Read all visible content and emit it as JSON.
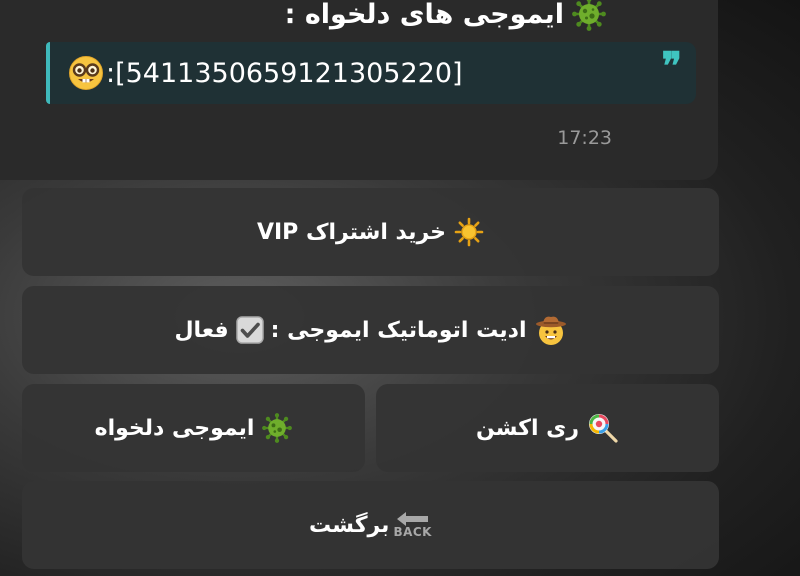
{
  "message": {
    "title": "ایموجی های دلخواه :",
    "title_icon": "virus-icon",
    "quote_mark": "❞",
    "quote_text": ":[5411350659121305220]",
    "quote_emoji": "nerd-face-icon",
    "time": "17:23",
    "accent_color": "#3fb9bb",
    "quote_bg": "#1f3135"
  },
  "keyboard": {
    "vip": {
      "label": "خرید اشتراک VIP",
      "icon": "sun-icon"
    },
    "auto_update": {
      "label": "ادیت اتوماتیک ایموجی :",
      "status": "فعال",
      "icon": "cowboy-face-icon",
      "check_icon": "check-box-icon"
    },
    "reaction": {
      "label": "ری اکشن",
      "icon": "lollipop-icon"
    },
    "custom_emoji": {
      "label": "ایموجی دلخواه",
      "icon": "virus-icon"
    },
    "back": {
      "label": "برگشت",
      "icon": "back-arrow-icon",
      "icon_text": "BACK"
    }
  },
  "colors": {
    "button_bg": "#343434",
    "bubble_bg": "#2a2a2a",
    "text": "#ffffff",
    "time": "#9a9a9a"
  }
}
